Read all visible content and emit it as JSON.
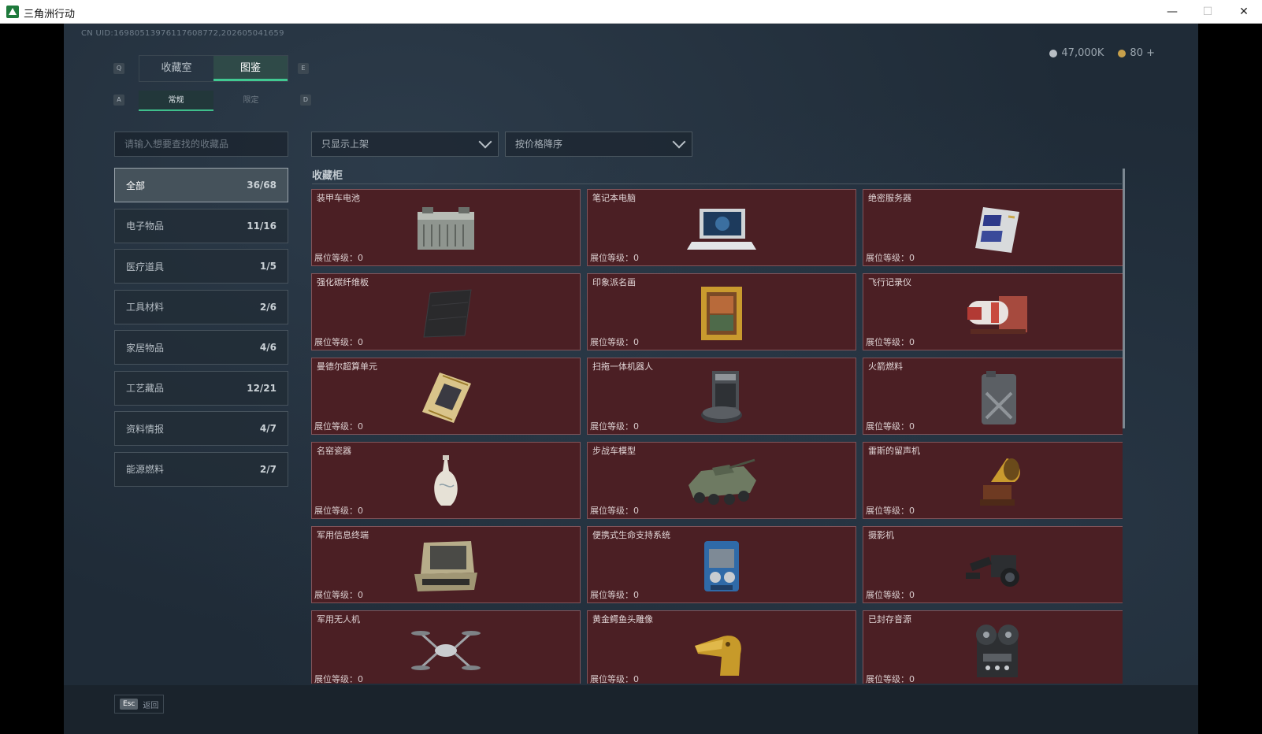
{
  "window": {
    "title": "三角洲行动"
  },
  "uid": "CN UID:16980513976117608772,202605041659",
  "currency": {
    "coins": "47,000K",
    "tickets": "80 +"
  },
  "tabs": {
    "main": [
      "收藏室",
      "图鉴"
    ],
    "active_main": 1,
    "sub": [
      "常规",
      "限定"
    ],
    "active_sub": 0,
    "key_hints": [
      "Q",
      "E",
      "A",
      "D"
    ]
  },
  "search": {
    "placeholder": "请输入想要查找的收藏品"
  },
  "categories": [
    {
      "label": "全部",
      "count": "36/68"
    },
    {
      "label": "电子物品",
      "count": "11/16"
    },
    {
      "label": "医疗道具",
      "count": "1/5"
    },
    {
      "label": "工具材料",
      "count": "2/6"
    },
    {
      "label": "家居物品",
      "count": "4/6"
    },
    {
      "label": "工艺藏品",
      "count": "12/21"
    },
    {
      "label": "资料情报",
      "count": "4/7"
    },
    {
      "label": "能源燃料",
      "count": "2/7"
    }
  ],
  "filters": {
    "display": "只显示上架",
    "sort": "按价格降序"
  },
  "section": {
    "title": "收藏柜"
  },
  "level_label": "展位等级：",
  "items": [
    {
      "name": "装甲车电池",
      "level": "0",
      "icon": "battery-icon"
    },
    {
      "name": "笔记本电脑",
      "level": "0",
      "icon": "laptop-icon"
    },
    {
      "name": "绝密服务器",
      "level": "0",
      "icon": "server-icon"
    },
    {
      "name": "强化碳纤维板",
      "level": "0",
      "icon": "carbon-plate-icon"
    },
    {
      "name": "印象派名画",
      "level": "0",
      "icon": "painting-icon"
    },
    {
      "name": "飞行记录仪",
      "level": "0",
      "icon": "flight-recorder-icon"
    },
    {
      "name": "曼德尔超算单元",
      "level": "0",
      "icon": "cpu-icon"
    },
    {
      "name": "扫拖一体机器人",
      "level": "0",
      "icon": "robot-vacuum-icon"
    },
    {
      "name": "火箭燃料",
      "level": "0",
      "icon": "fuel-can-icon"
    },
    {
      "name": "名窑瓷器",
      "level": "0",
      "icon": "vase-icon"
    },
    {
      "name": "步战车模型",
      "level": "0",
      "icon": "ifv-model-icon"
    },
    {
      "name": "雷斯的留声机",
      "level": "0",
      "icon": "gramophone-icon"
    },
    {
      "name": "军用信息终端",
      "level": "0",
      "icon": "terminal-icon"
    },
    {
      "name": "便携式生命支持系统",
      "level": "0",
      "icon": "life-support-icon"
    },
    {
      "name": "摄影机",
      "level": "0",
      "icon": "camera-icon"
    },
    {
      "name": "军用无人机",
      "level": "0",
      "icon": "drone-icon"
    },
    {
      "name": "黄金鳄鱼头雕像",
      "level": "0",
      "icon": "gold-statue-icon"
    },
    {
      "name": "已封存音源",
      "level": "0",
      "icon": "reel-recorder-icon"
    }
  ],
  "footer": {
    "esc_key": "Esc",
    "back_label": "返回"
  },
  "colors": {
    "card_bg": "#4b1f24",
    "card_border": "#80545a",
    "accent": "#41c992",
    "panel_bg": "#1f2b37"
  }
}
